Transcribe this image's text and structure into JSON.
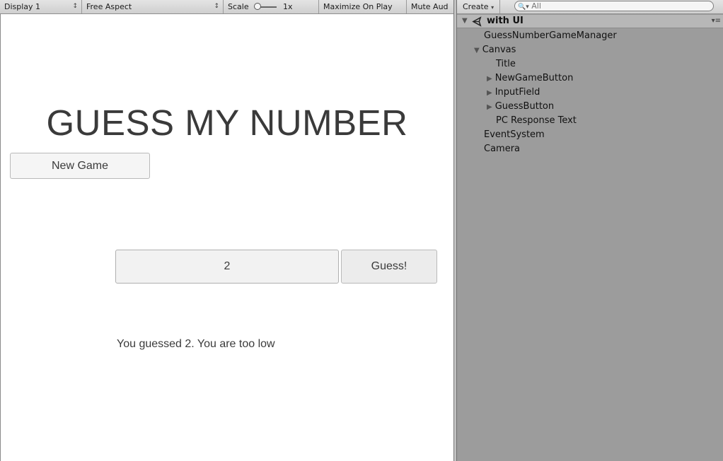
{
  "game_toolbar": {
    "display": "Display 1",
    "aspect": "Free Aspect",
    "scale_label": "Scale",
    "scale_value": "1x",
    "maximize": "Maximize On Play",
    "mute": "Mute Aud"
  },
  "game": {
    "title": "GUESS MY NUMBER",
    "new_game_label": "New Game",
    "input_value": "2",
    "guess_label": "Guess!",
    "response_text": "You guessed 2. You are too low"
  },
  "hierarchy": {
    "create_label": "Create",
    "search_placeholder": "All",
    "scene_name": "with UI",
    "items": [
      {
        "label": "GuessNumberGameManager",
        "depth": 0,
        "fold": ""
      },
      {
        "label": "Canvas",
        "depth": 0,
        "fold": "open"
      },
      {
        "label": "Title",
        "depth": 1,
        "fold": ""
      },
      {
        "label": "NewGameButton",
        "depth": 1,
        "fold": "closed"
      },
      {
        "label": "InputField",
        "depth": 1,
        "fold": "closed"
      },
      {
        "label": "GuessButton",
        "depth": 1,
        "fold": "closed"
      },
      {
        "label": "PC Response Text",
        "depth": 1,
        "fold": ""
      },
      {
        "label": "EventSystem",
        "depth": 0,
        "fold": ""
      },
      {
        "label": "Camera",
        "depth": 0,
        "fold": ""
      }
    ]
  }
}
